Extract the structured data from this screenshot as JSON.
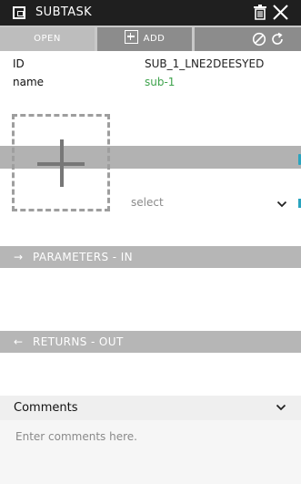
{
  "window": {
    "title": "SUBTASK",
    "icons": [
      "window-icon",
      "trash-icon",
      "close-icon"
    ]
  },
  "toolbar": {
    "open_label": "OPEN",
    "add_label": "ADD",
    "icons": [
      "block-icon",
      "refresh-icon"
    ]
  },
  "info": {
    "id_label": "ID",
    "id_value": "SUB_1_LNE2DEESYED",
    "name_label": "name",
    "name_value": "sub-1"
  },
  "select": {
    "value": "select"
  },
  "sections": {
    "params_in": "PARAMETERS - IN",
    "returns_out": "RETURNS - OUT"
  },
  "comments": {
    "title": "Comments",
    "placeholder": "Enter comments here."
  },
  "colors": {
    "titlebar": "#1f1f1f",
    "name_value": "#3fa34d",
    "port_marker": "#2aa4bf",
    "section_bar": "#b6b6b6"
  }
}
